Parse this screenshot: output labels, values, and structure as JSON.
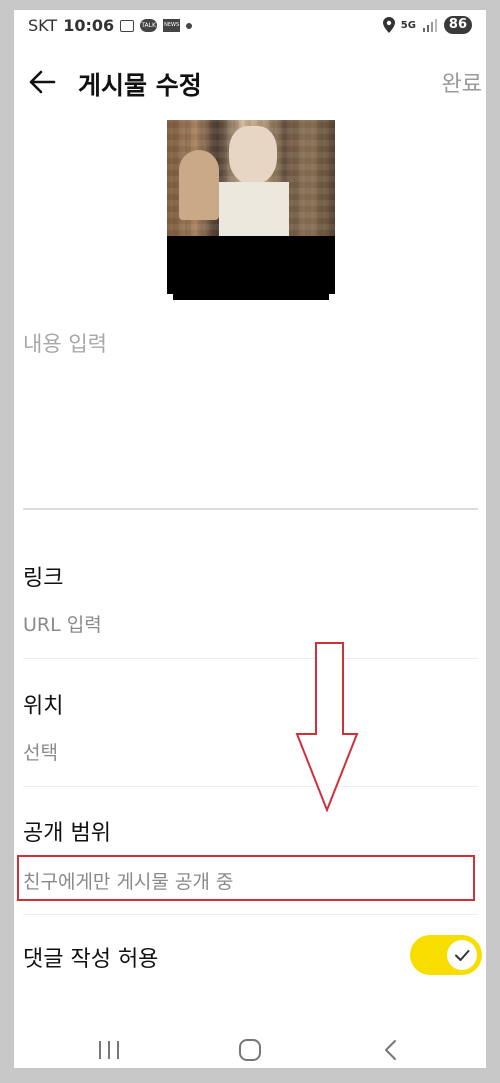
{
  "status_bar": {
    "carrier": "SKT",
    "time": "10:06",
    "battery": "86",
    "network": "5G",
    "notification_icons": [
      "screenshot-icon",
      "kakaotalk-icon",
      "news-icon",
      "dot-icon"
    ],
    "system_icons": [
      "location-icon",
      "5g-icon",
      "signal-icon",
      "battery-icon"
    ]
  },
  "app_bar": {
    "title": "게시물 수정",
    "done_label": "완료"
  },
  "post": {
    "content_placeholder": "내용 입력",
    "content_value": ""
  },
  "sections": {
    "link": {
      "label": "링크",
      "value": "URL 입력"
    },
    "location": {
      "label": "위치",
      "value": "선택"
    },
    "visibility": {
      "label": "공개 범위",
      "value": "친구에게만 게시물 공개 중"
    },
    "comments": {
      "label": "댓글 작성 허용",
      "enabled": true
    }
  },
  "colors": {
    "toggle_on": "#f8de00",
    "annotation": "#d0303a",
    "divider": "#dcdcdc",
    "secondary_text": "#8a8a8a"
  }
}
